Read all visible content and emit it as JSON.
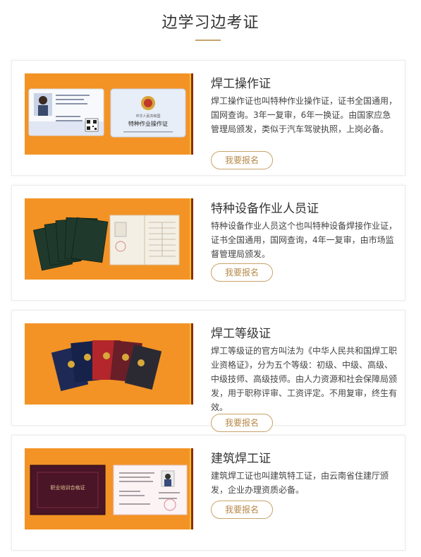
{
  "page": {
    "title": "边学习边考证"
  },
  "cards": [
    {
      "title": "焊工操作证",
      "description": "焊工操作证也叫特种作业操作证，证书全国通用，国网查询。3年一复审，6年一换证。由国家应急管理局颁发，类似于汽车驾驶执照，上岗必备。",
      "button_label": "我要报名",
      "image": {
        "id_card_heading": "中华人民共和国",
        "id_card_title": "特种作业操作证"
      }
    },
    {
      "title": "特种设备作业人员证",
      "description": "特种设备作业人员这个也叫特种设备焊接作业证，证书全国通用，国网查询，4年一复审，由市场监督管理局颁发。",
      "button_label": "我要报名"
    },
    {
      "title": "焊工等级证",
      "description": "焊工等级证的官方叫法为《中华人民共和国焊工职业资格证》，分为五个等级：初级、中级、高级、中级技师、高级技师。由人力资源和社会保障局颁发，用于职称评审、工资评定。不用复审，终生有效。",
      "button_label": "我要报名"
    },
    {
      "title": "建筑焊工证",
      "description": "建筑焊工证也叫建筑特工证，由云南省住建厅颁发，企业办理资质必备。",
      "button_label": "我要报名",
      "image": {
        "cert_title": "职业培训合格证"
      }
    }
  ],
  "colors": {
    "accent": "#c9a36a",
    "image_bg": "#f39325"
  }
}
